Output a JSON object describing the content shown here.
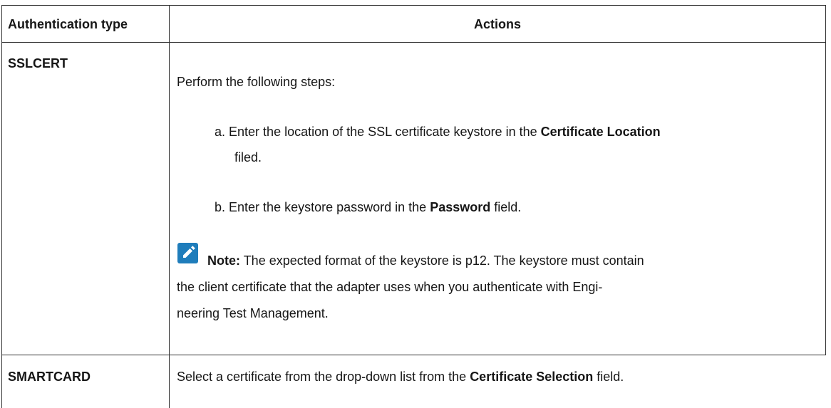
{
  "table": {
    "headers": {
      "auth_type": "Authentication type",
      "actions": "Actions"
    },
    "rows": [
      {
        "auth_type": "SSLCERT",
        "intro": "Perform the following steps:",
        "steps": [
          {
            "marker": "a.",
            "pre": "Enter the location of the SSL certificate keystore in the",
            "bold": "Certificate Location",
            "post": "filed."
          },
          {
            "marker": "b.",
            "pre": "Enter the keystore password in the",
            "bold": "Password",
            "post": "field."
          }
        ],
        "note": {
          "label": "Note:",
          "line1": "The expected format of the keystore is p12. The keystore must contain",
          "line2": "the client certificate that the adapter uses when you authenticate with Engi-",
          "line3": "neering Test Management."
        }
      },
      {
        "auth_type": "SMARTCARD",
        "pre": "Select a certificate from the drop-down list from the",
        "bold": "Certificate Selection",
        "post": "field."
      }
    ]
  },
  "icons": {
    "note_icon": "pencil-note-icon",
    "note_icon_color": "#1f7dbb"
  }
}
